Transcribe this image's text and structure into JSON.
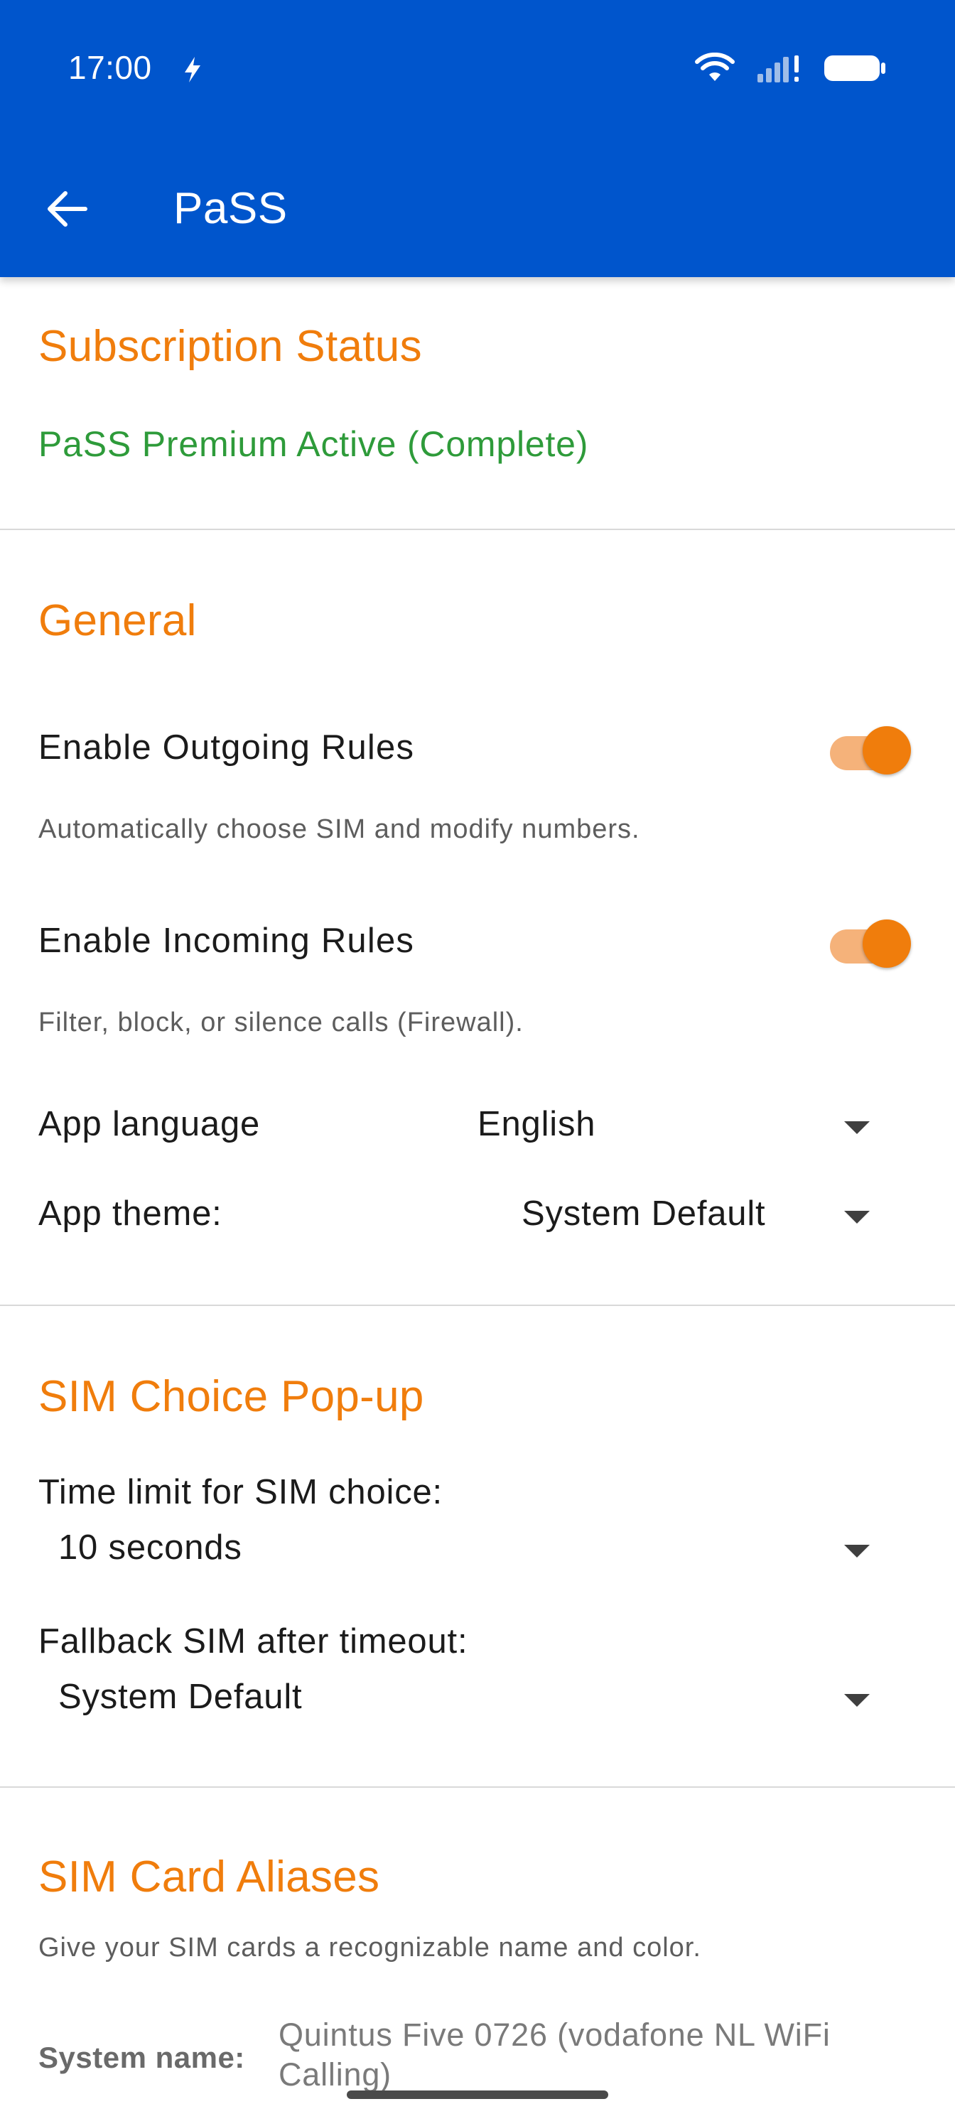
{
  "status_bar": {
    "time": "17:00",
    "icons": [
      "flash-icon",
      "wifi-icon",
      "signal-icon",
      "battery-icon"
    ]
  },
  "app_bar": {
    "title": "PaSS",
    "back_icon": "arrow-left-icon"
  },
  "colors": {
    "app_bar": "#0055cc",
    "accent": "#f07d0c",
    "success": "#2e9b3a",
    "toggle_track": "#f5b27a"
  },
  "subscription": {
    "title": "Subscription Status",
    "status": "PaSS Premium Active (Complete)"
  },
  "general": {
    "title": "General",
    "outgoing": {
      "label": "Enable Outgoing Rules",
      "description": "Automatically choose SIM and modify numbers.",
      "enabled": true
    },
    "incoming": {
      "label": "Enable Incoming Rules",
      "description": "Filter, block, or silence calls (Firewall).",
      "enabled": true
    },
    "language": {
      "label": "App language",
      "value": "English"
    },
    "theme": {
      "label": "App theme:",
      "value": "System Default"
    }
  },
  "sim_popup": {
    "title": "SIM Choice Pop-up",
    "time_limit": {
      "label": "Time limit for SIM choice:",
      "value": "10 seconds"
    },
    "fallback": {
      "label": "Fallback SIM after timeout:",
      "value": "System Default"
    }
  },
  "aliases": {
    "title": "SIM Card Aliases",
    "description": "Give your SIM cards a recognizable name and color.",
    "system_name_label": "System name:",
    "system_name_value": "Quintus Five 0726 (vodafone NL WiFi Calling)"
  }
}
